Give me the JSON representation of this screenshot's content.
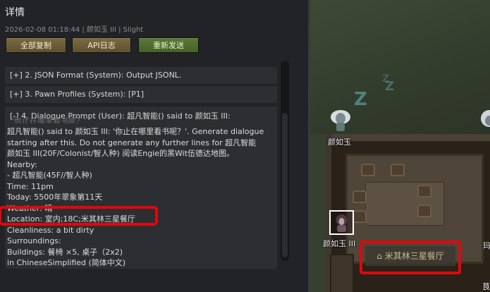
{
  "panel": {
    "title": "详情",
    "meta": "2026-02-08 01:18:44  |  颜如玉 III  |  Slight",
    "buttons": {
      "copy_all": "全部复制",
      "api_log": "API日志",
      "resend": "重新发送"
    },
    "sections": [
      {
        "toggle": "[+]",
        "label": "2. JSON Format (System): Output JSONL."
      },
      {
        "toggle": "[+]",
        "label": "3. Pawn Profiles (System): [P1]"
      },
      {
        "toggle": "[-]",
        "label": "4. Dialogue Prompt (User): 超凡智能() said to 颜如玉 III:"
      }
    ],
    "faded_line": "'你止在哪里看书呢？'",
    "body_lines": [
      "超凡智能() said to 颜如玉 III: '你止在哪里看书呢？'. Generate dialogue",
      "starting after this. Do not generate any further lines for 超凡智能",
      "颜如玉 III(20F/Colonist/智人种) 阅读Engie的黑Wit伍德达地图。",
      "Nearby:",
      "- 超凡智能(45F//智人种)",
      "Time: 11pm",
      "Today: 5500年翠象第11天",
      "Weather: 晴",
      "Location: 室内;18C;米其林三星餐厅",
      "Cleanliness: a bit dirty",
      "Surroundings:",
      "Buildings: 餐椅 ×5, 桌子（2x2)",
      "in ChineseSimplified (简体中文)"
    ]
  },
  "map": {
    "pawn_top_label": "颜如玉",
    "pawn_selected_label": "颜如玉 III",
    "room_label": "米其林三星餐厅",
    "edge_text_a": "玛",
    "edge_text_b": "茛",
    "sleep_letter": "Z"
  },
  "colors": {
    "highlight": "#e0080d",
    "panel_bg": "#222326",
    "button_gold": "#7b6a41",
    "button_green": "#5a7a36"
  }
}
